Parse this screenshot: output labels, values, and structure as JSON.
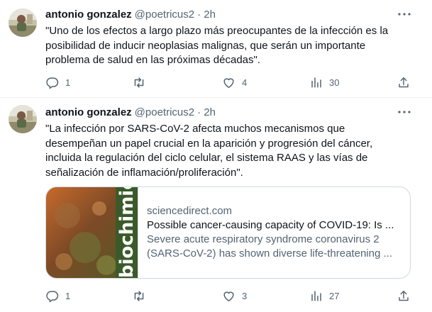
{
  "tweets": [
    {
      "author_name": "antonio gonzalez",
      "handle": "@poetricus2",
      "time": "· 2h",
      "lines": [
        "\"Uno de los efectos a largo plazo más preocupantes de la infección es la",
        "posibilidad de inducir neoplasias malignas, que serán un importante",
        "problema de salud en las próximas décadas\"."
      ],
      "replies": "1",
      "retweets": "",
      "likes": "4",
      "views": "30"
    },
    {
      "author_name": "antonio gonzalez",
      "handle": "@poetricus2",
      "time": "· 2h",
      "lines": [
        "\"La infección por SARS-CoV-2 afecta muchos mecanismos que",
        "desempeñan un papel crucial en la aparición y progresión del cáncer,",
        "incluida la regulación del ciclo celular, el sistema RAAS y las vías de",
        "señalización de inflamación/proliferación\"."
      ],
      "card": {
        "image_text": "biochimie",
        "domain": "sciencedirect.com",
        "title": "Possible cancer-causing capacity of COVID-19: Is ...",
        "desc_lines": [
          "Severe acute respiratory syndrome coronavirus 2",
          "(SARS-CoV-2) has shown diverse life-threatening ..."
        ]
      },
      "replies": "1",
      "retweets": "",
      "likes": "3",
      "views": "27"
    }
  ],
  "icons": {
    "reply": "reply-icon",
    "retweet": "retweet-icon",
    "like": "heart-icon",
    "views": "views-icon",
    "share": "share-icon",
    "more": "more-icon"
  },
  "colors": {
    "secondary_text": "#536471",
    "border": "#cfd9de"
  }
}
